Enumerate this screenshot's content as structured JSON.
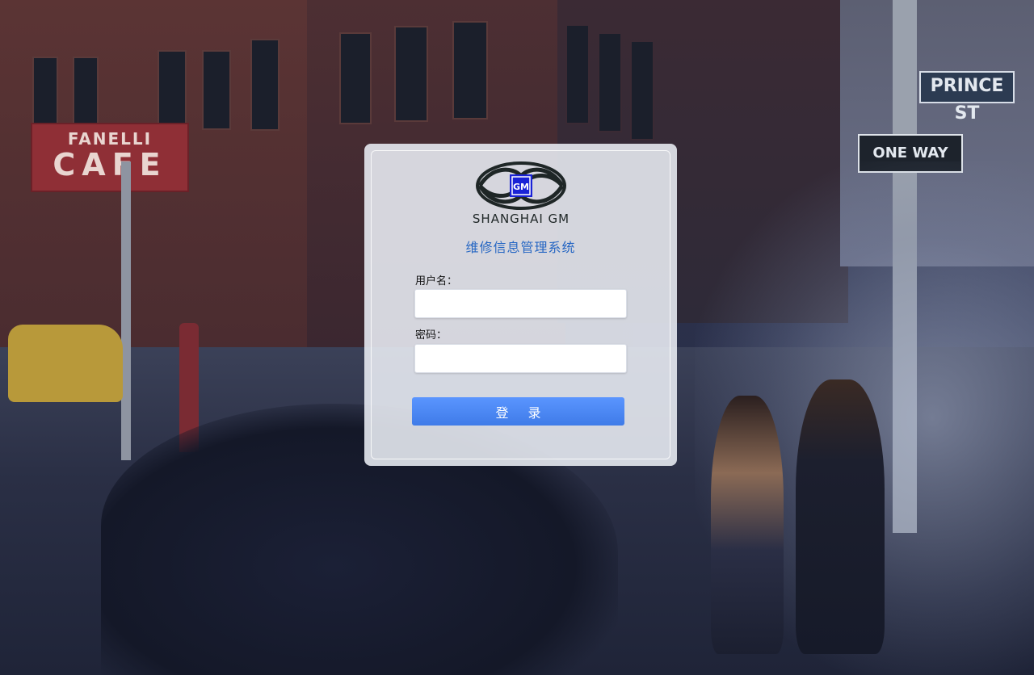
{
  "background": {
    "cafe_sign_line1": "FANELLI",
    "cafe_sign_line2": "CAFE",
    "street_sign": "PRINCE ST",
    "oneway_sign": "ONE WAY"
  },
  "login": {
    "logo_badge": "GM",
    "logo_text": "SHANGHAI GM",
    "system_title": "维修信息管理系统",
    "username_label": "用户名：",
    "username_value": "",
    "password_label": "密码：",
    "password_value": "",
    "submit_label": "登录"
  },
  "colors": {
    "accent_title": "#2566c3",
    "button": "#4a86f2",
    "logo_blue": "#1a23d6"
  }
}
